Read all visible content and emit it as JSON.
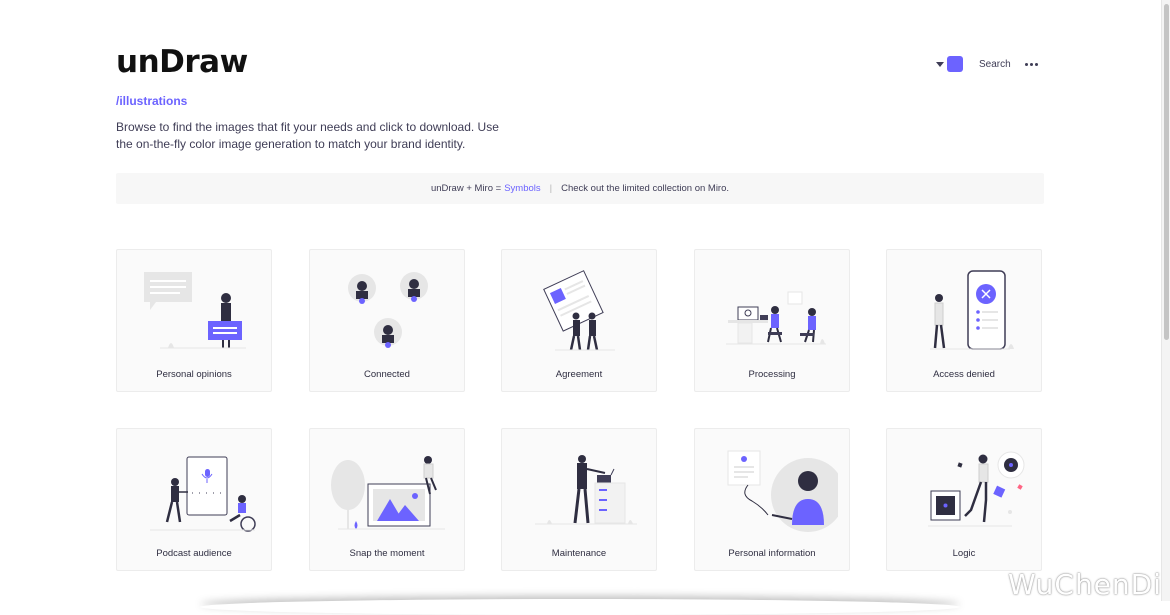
{
  "header": {
    "logo": "unDraw",
    "subtitle": "/illustrations",
    "intro": "Browse to find the images that fit your needs and click to download. Use the on-the-fly color image generation to match your brand identity.",
    "accent_color": "#6c63ff",
    "search_label": "Search",
    "menu_icon": "more-horizontal-icon"
  },
  "banner": {
    "prefix": "unDraw + Miro = ",
    "link": "Symbols",
    "separator": "|",
    "text": "Check out the limited collection on Miro."
  },
  "cards": [
    {
      "label": "Personal opinions"
    },
    {
      "label": "Connected"
    },
    {
      "label": "Agreement"
    },
    {
      "label": "Processing"
    },
    {
      "label": "Access denied"
    },
    {
      "label": "Podcast audience"
    },
    {
      "label": "Snap the moment"
    },
    {
      "label": "Maintenance"
    },
    {
      "label": "Personal information"
    },
    {
      "label": "Logic"
    }
  ],
  "watermark": "WuChenDi"
}
